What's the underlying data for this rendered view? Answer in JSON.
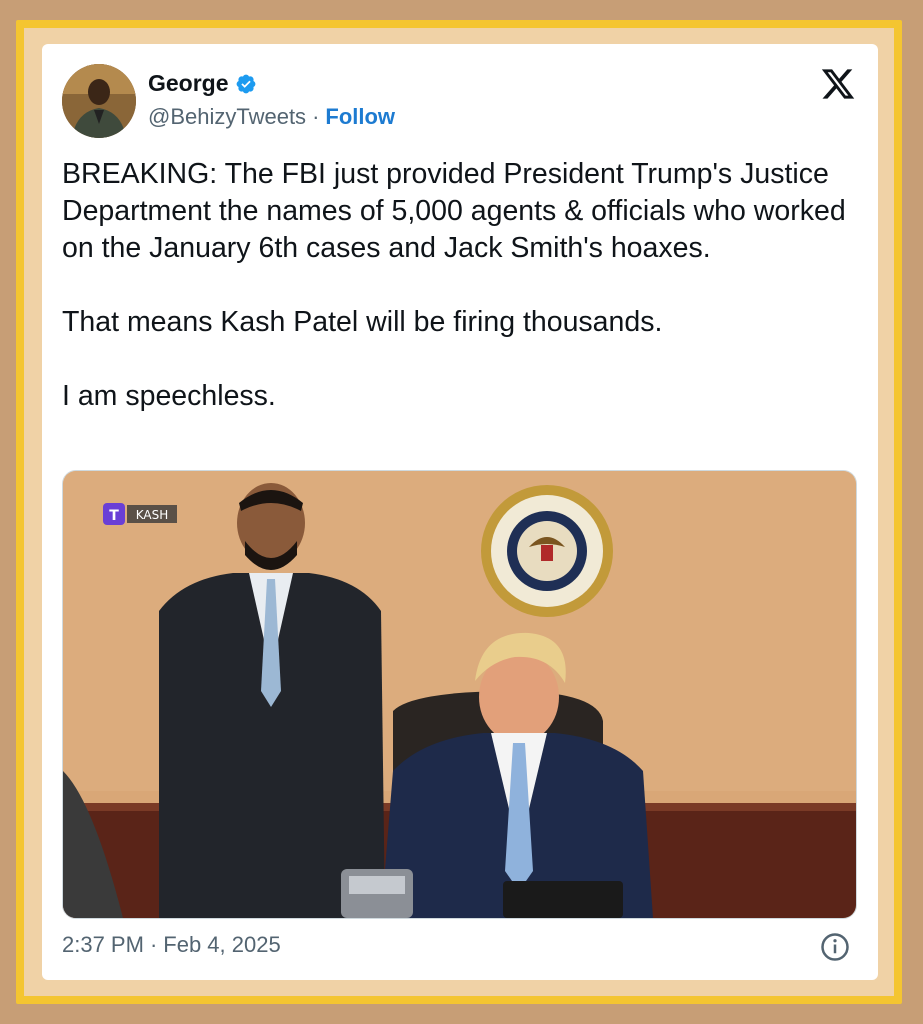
{
  "author": {
    "name": "George",
    "handle": "@BehizyTweets",
    "separator": "·",
    "follow_label": "Follow",
    "verified_icon": "verified-badge-icon",
    "verified_color": "#1d9bf0"
  },
  "brand_icon": "x-logo-icon",
  "tweet": {
    "text": "BREAKING: The FBI just provided President Trump's Justice Department the names of 5,000 agents & officials who worked on the January 6th cases and Jack Smith's hoaxes.\n\nThat means Kash Patel will be firing thousands.\n\nI am speechless."
  },
  "media": {
    "watermark_label": "KASH",
    "watermark_icon": "T"
  },
  "footer": {
    "time": "2:37 PM",
    "separator": "·",
    "date": "Feb 4, 2025",
    "info_icon": "info-icon"
  },
  "colors": {
    "background": "#c79e76",
    "frame": "#f4c531",
    "accent": "#1d7bd1"
  }
}
